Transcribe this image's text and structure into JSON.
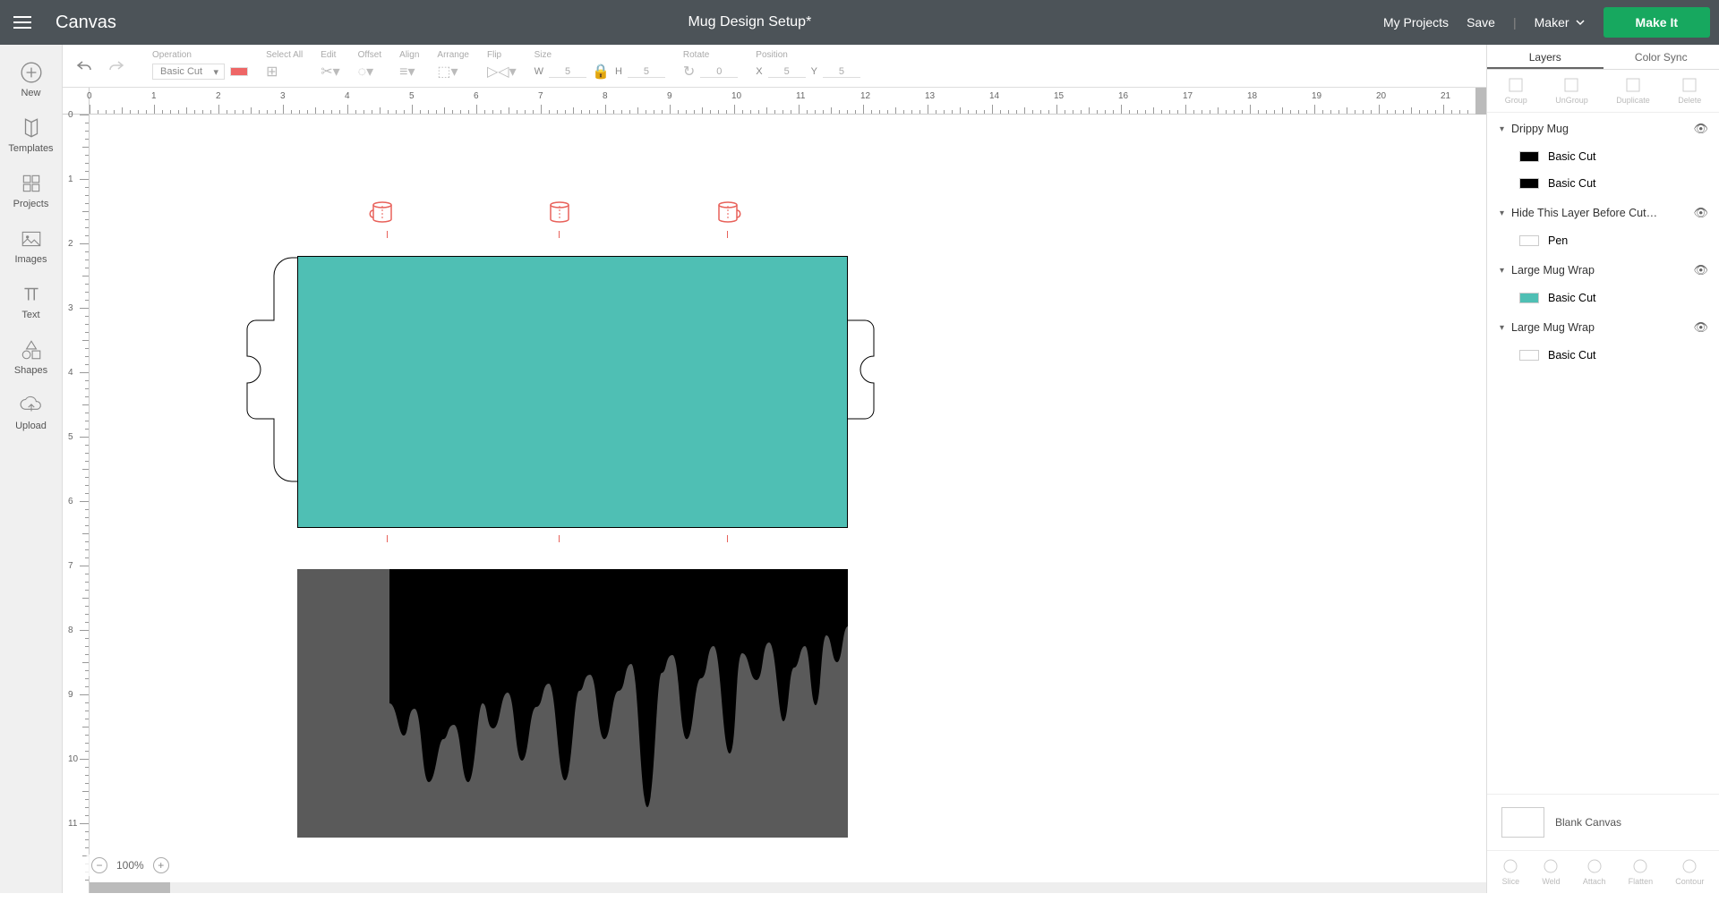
{
  "header": {
    "app_label": "Canvas",
    "project_title": "Mug Design Setup*",
    "my_projects": "My Projects",
    "save": "Save",
    "machine": "Maker",
    "make_it": "Make It"
  },
  "sidebar": {
    "items": [
      {
        "label": "New"
      },
      {
        "label": "Templates"
      },
      {
        "label": "Projects"
      },
      {
        "label": "Images"
      },
      {
        "label": "Text"
      },
      {
        "label": "Shapes"
      },
      {
        "label": "Upload"
      }
    ]
  },
  "toolbar": {
    "operation_label": "Operation",
    "operation_value": "Basic Cut",
    "select_all": "Select All",
    "edit": "Edit",
    "offset": "Offset",
    "align": "Align",
    "arrange": "Arrange",
    "flip": "Flip",
    "size": "Size",
    "size_w": "W",
    "size_w_val": "5",
    "size_h": "H",
    "size_h_val": "5",
    "rotate": "Rotate",
    "rotate_val": "0",
    "position": "Position",
    "pos_x": "X",
    "pos_x_val": "5",
    "pos_y": "Y",
    "pos_y_val": "5"
  },
  "ruler": {
    "h_ticks": [
      0,
      1,
      2,
      3,
      4,
      5,
      6,
      7,
      8,
      9,
      10,
      11,
      12,
      13,
      14,
      15,
      16,
      17,
      18,
      19,
      20,
      21
    ],
    "v_ticks": [
      0,
      1,
      2,
      3,
      4,
      5,
      6,
      7,
      8,
      9,
      10,
      11
    ]
  },
  "rpanel": {
    "tabs": {
      "layers": "Layers",
      "colorsync": "Color Sync"
    },
    "ops_top": [
      "Group",
      "UnGroup",
      "Duplicate",
      "Delete"
    ],
    "layers": [
      {
        "name": "Drippy Mug",
        "children": [
          {
            "name": "Basic Cut",
            "swatch": "#000"
          },
          {
            "name": "Basic Cut",
            "swatch": "#000"
          }
        ]
      },
      {
        "name": "Hide This Layer Before Cut…",
        "children": [
          {
            "name": "Pen",
            "swatch": "#fff"
          }
        ]
      },
      {
        "name": "Large Mug Wrap",
        "children": [
          {
            "name": "Basic Cut",
            "swatch": "#4fbfb4"
          }
        ]
      },
      {
        "name": "Large Mug Wrap",
        "children": [
          {
            "name": "Basic Cut",
            "swatch": "#fff"
          }
        ]
      }
    ],
    "canvas_label": "Blank Canvas",
    "ops_bottom": [
      "Slice",
      "Weld",
      "Attach",
      "Flatten",
      "Contour"
    ]
  },
  "zoom": {
    "value": "100%"
  }
}
